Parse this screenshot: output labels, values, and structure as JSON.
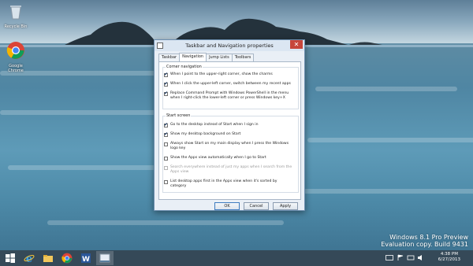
{
  "desktop_icons": [
    {
      "label": "Recycle Bin",
      "icon": "recycle-bin-icon"
    },
    {
      "label": "Google Chrome",
      "icon": "chrome-icon"
    }
  ],
  "watermark": {
    "line1": "Windows 8.1 Pro Preview",
    "line2": "Evaluation copy. Build 9431"
  },
  "dialog": {
    "title": "Taskbar and Navigation properties",
    "close": "✕",
    "tabs": [
      "Taskbar",
      "Navigation",
      "Jump Lists",
      "Toolbars"
    ],
    "active_tab": "Navigation",
    "corner_group": {
      "label": "Corner navigation",
      "options": [
        {
          "text": "When I point to the upper-right corner, show the charms",
          "checked": true
        },
        {
          "text": "When I click the upper-left corner, switch between my recent apps",
          "checked": true
        },
        {
          "text": "Replace Command Prompt with Windows PowerShell in the menu when I right-click the lower-left corner or press Windows key+X",
          "checked": true
        }
      ]
    },
    "start_group": {
      "label": "Start screen",
      "options": [
        {
          "text": "Go to the desktop instead of Start when I sign in",
          "checked": true
        },
        {
          "text": "Show my desktop background on Start",
          "checked": true
        },
        {
          "text": "Always show Start on my main display when I press the Windows logo key",
          "checked": false
        },
        {
          "text": "Show the Apps view automatically when I go to Start",
          "checked": false
        },
        {
          "text": "Search everywhere instead of just my apps when I search from the Apps view",
          "checked": false,
          "disabled": true
        },
        {
          "text": "List desktop apps first in the Apps view when it's sorted by category",
          "checked": false
        }
      ]
    },
    "buttons": {
      "ok": "OK",
      "cancel": "Cancel",
      "apply": "Apply"
    }
  },
  "taskbar": {
    "apps": [
      "windows-start-icon",
      "internet-explorer-icon",
      "file-explorer-icon",
      "chrome-icon",
      "word-icon",
      "taskbar-properties-icon"
    ],
    "clock": {
      "time": "4:38 PM",
      "date": "6/27/2013"
    }
  },
  "colors": {
    "accent": "#3d7bbf",
    "close": "#c7453a",
    "taskbar": "#243a4a"
  }
}
